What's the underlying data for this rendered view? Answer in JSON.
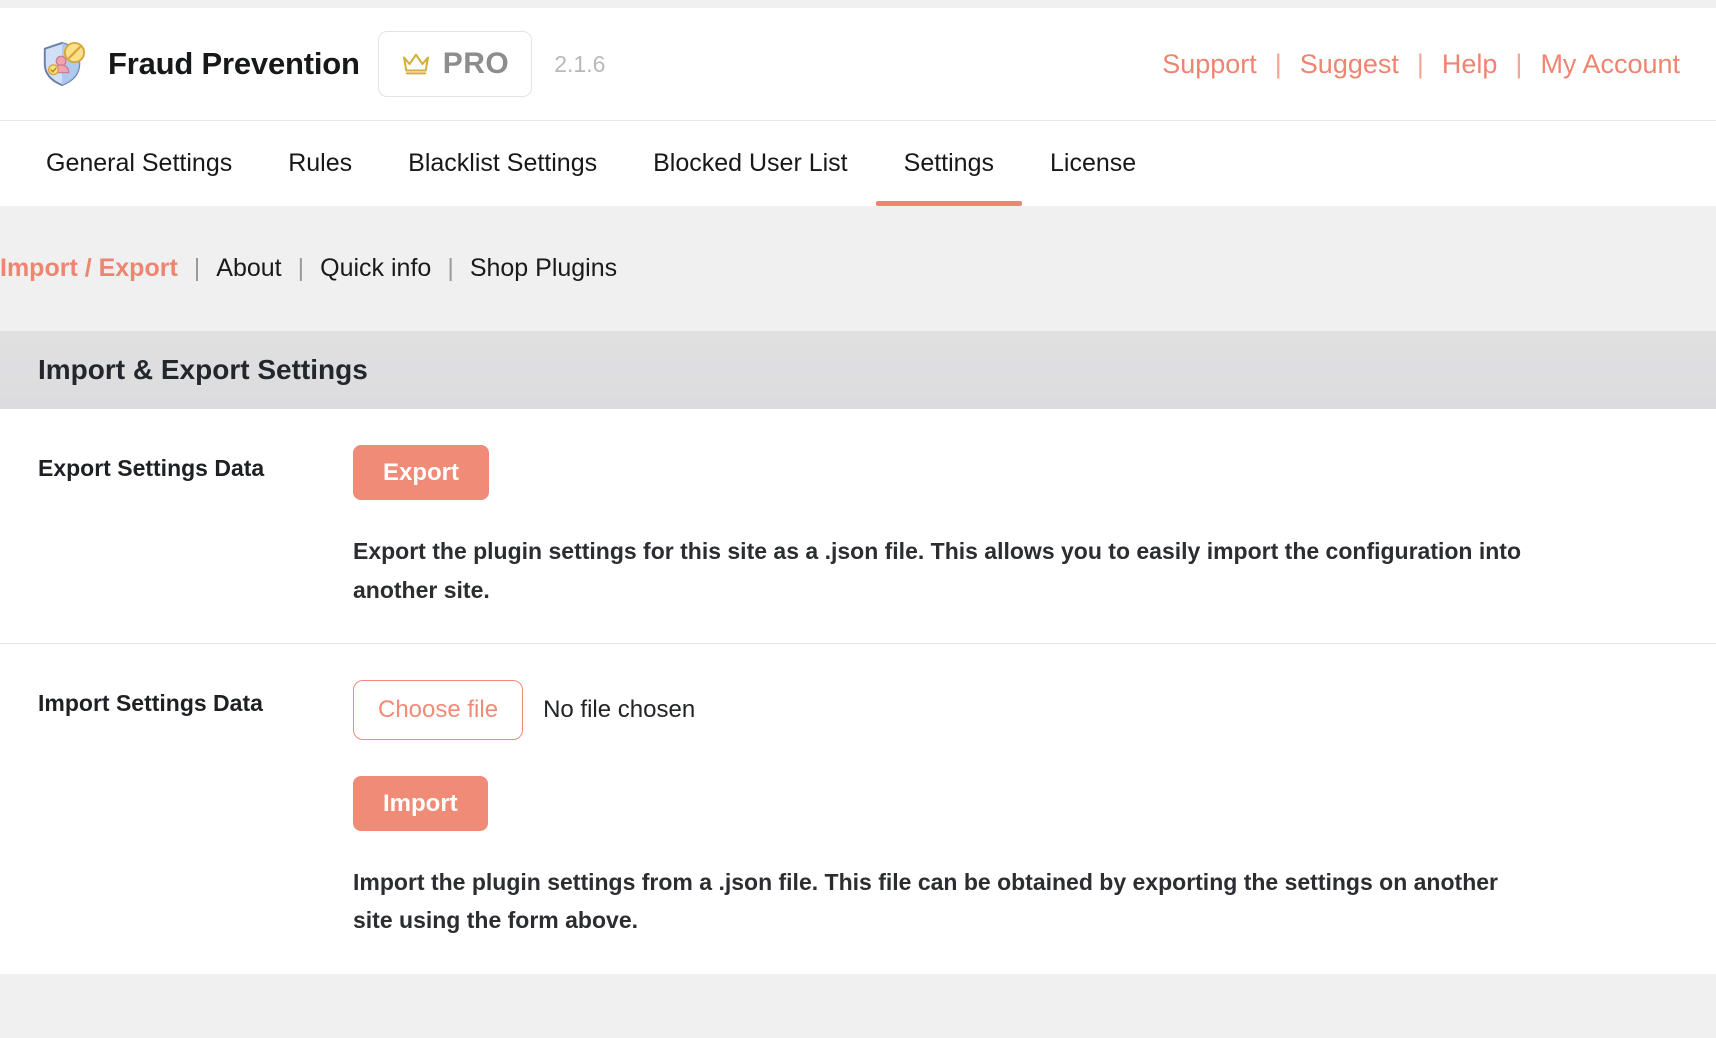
{
  "header": {
    "logo_icon": "shield-user-block-icon",
    "brand_title": "Fraud Prevention",
    "pro_badge": {
      "icon": "crown-icon",
      "label": "PRO"
    },
    "version": "2.1.6",
    "links": [
      {
        "label": "Support"
      },
      {
        "label": "Suggest"
      },
      {
        "label": "Help"
      },
      {
        "label": "My Account"
      }
    ],
    "separator": "|"
  },
  "tabs": [
    {
      "label": "General Settings",
      "active": false
    },
    {
      "label": "Rules",
      "active": false
    },
    {
      "label": "Blacklist Settings",
      "active": false
    },
    {
      "label": "Blocked User List",
      "active": false
    },
    {
      "label": "Settings",
      "active": true
    },
    {
      "label": "License",
      "active": false
    }
  ],
  "subnav": {
    "separator": "|",
    "items": [
      {
        "label": "Import / Export",
        "active": true
      },
      {
        "label": "About",
        "active": false
      },
      {
        "label": "Quick info",
        "active": false
      },
      {
        "label": "Shop Plugins",
        "active": false
      }
    ]
  },
  "section": {
    "title": "Import & Export Settings"
  },
  "export_row": {
    "label": "Export Settings Data",
    "button_label": "Export",
    "description": "Export the plugin settings for this site as a .json file. This allows you to easily import the configuration into another site."
  },
  "import_row": {
    "label": "Import Settings Data",
    "choose_file_label": "Choose file",
    "file_status": "No file chosen",
    "button_label": "Import",
    "description": "Import the plugin settings from a .json file. This file can be obtained by exporting the settings on another site using the form above."
  },
  "colors": {
    "accent": "#ee8571",
    "button": "#ef8b76",
    "text": "#1e2023",
    "muted": "#b9b9ba",
    "page_bg": "#f0f0f1",
    "section_bg": "#dedede",
    "crown": "#d4af37"
  }
}
